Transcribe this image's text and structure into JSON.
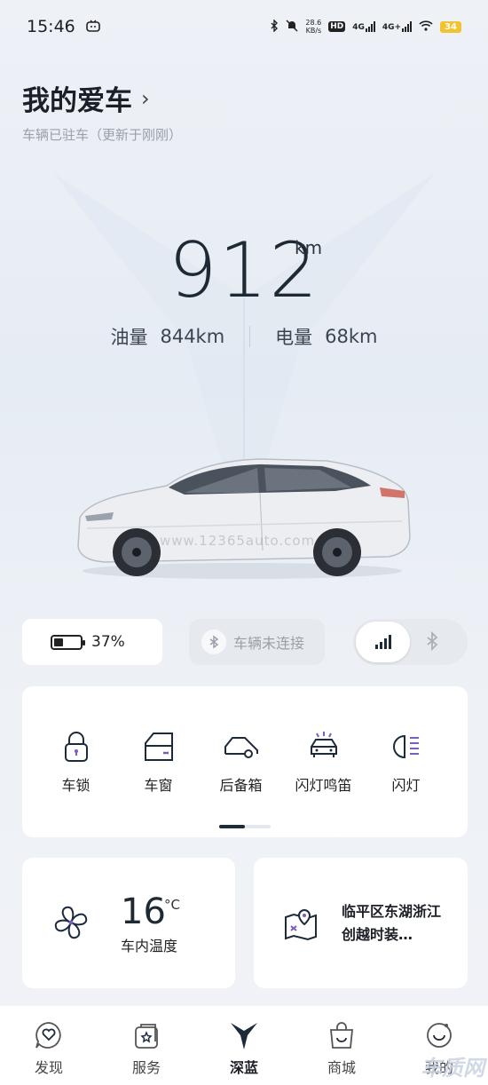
{
  "status_bar": {
    "time": "15:46",
    "net_speed_value": "28.6",
    "net_speed_unit": "KB/s",
    "hd_label": "HD",
    "signal_1": "4G",
    "signal_2": "4G+",
    "battery": "34"
  },
  "header": {
    "title": "我的爱车",
    "subtitle": "车辆已驻车（更新于刚刚）"
  },
  "range": {
    "total": "912",
    "unit": "km",
    "fuel_label": "油量",
    "fuel_value": "844km",
    "electric_label": "电量",
    "electric_value": "68km"
  },
  "car": {
    "watermark": "www.12365auto.com"
  },
  "status_pills": {
    "battery_percent": "37%",
    "battery_level": 0.37,
    "bluetooth_status": "车辆未连接"
  },
  "controls": [
    {
      "label": "车锁",
      "icon": "lock-icon"
    },
    {
      "label": "车窗",
      "icon": "window-icon"
    },
    {
      "label": "后备箱",
      "icon": "trunk-icon"
    },
    {
      "label": "闪灯鸣笛",
      "icon": "flash-horn-icon"
    },
    {
      "label": "闪灯",
      "icon": "headlight-icon"
    }
  ],
  "temperature": {
    "value": "16",
    "unit": "°C",
    "label": "车内温度"
  },
  "location": {
    "text": "临平区东湖浙江创越时装…"
  },
  "tabbar": [
    {
      "label": "发现",
      "icon": "heart-chat-icon"
    },
    {
      "label": "服务",
      "icon": "star-bag-icon"
    },
    {
      "label": "深蓝",
      "icon": "deepal-logo-icon"
    },
    {
      "label": "商城",
      "icon": "shopping-bag-icon"
    },
    {
      "label": "我的",
      "icon": "profile-icon"
    }
  ],
  "corner_watermark": "车质网",
  "colors": {
    "accent_dark": "#1c2a3a",
    "battery_status": "#f2c230"
  }
}
